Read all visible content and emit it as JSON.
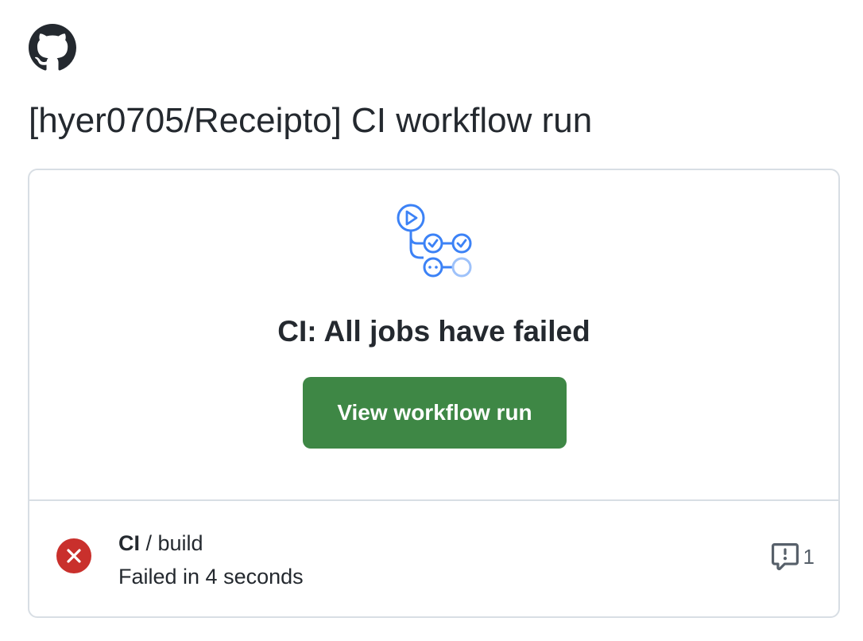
{
  "header": {
    "logo_icon": "github-mark-icon",
    "title": "[hyer0705/Receipto] CI workflow run"
  },
  "summary": {
    "icon": "workflow-run-icon",
    "headline": "CI: All jobs have failed",
    "button_label": "View workflow run",
    "button_color": "#3e8745"
  },
  "jobs": [
    {
      "status_icon": "x-circle-fill-icon",
      "status_color": "#cf222e",
      "workflow": "CI",
      "separator": " / ",
      "job": "build",
      "status_text": "Failed in 4 seconds",
      "annotation_icon": "comment-alert-icon",
      "annotation_count": "1"
    }
  ]
}
